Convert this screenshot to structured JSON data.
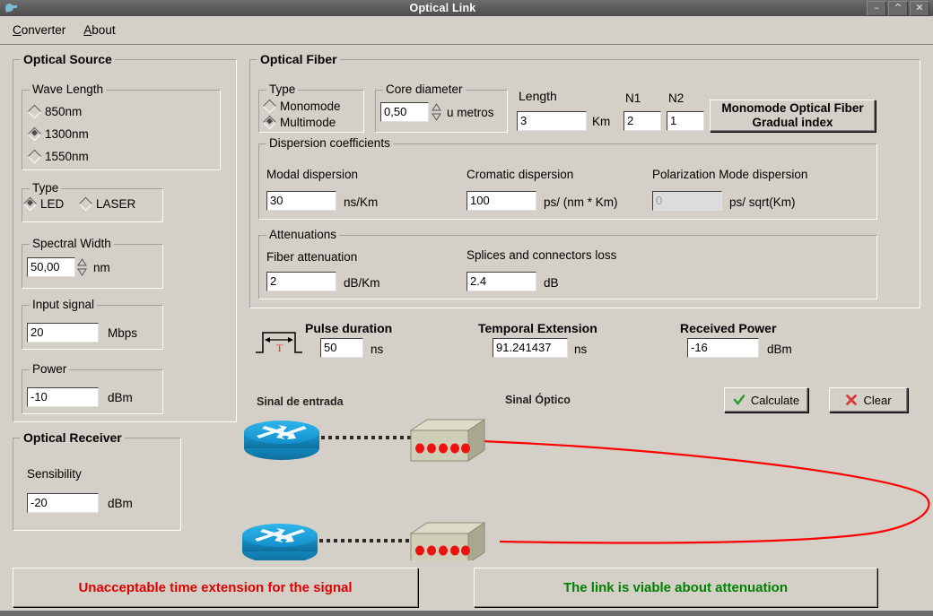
{
  "window": {
    "title": "Optical Link",
    "icon": "app-bird-icon",
    "controls": {
      "minimize": "–",
      "maximize": "^",
      "close": "✕"
    }
  },
  "menubar": {
    "items": [
      {
        "label": "Converter",
        "mnemonic": "C"
      },
      {
        "label": "About",
        "mnemonic": "A"
      }
    ]
  },
  "optical_source": {
    "title": "Optical Source",
    "wave_length": {
      "title": "Wave Length",
      "options": [
        {
          "label": "850nm",
          "selected": false
        },
        {
          "label": "1300nm",
          "selected": true
        },
        {
          "label": "1550nm",
          "selected": false
        }
      ]
    },
    "type": {
      "title": "Type",
      "options": [
        {
          "label": "LED",
          "selected": true
        },
        {
          "label": "LASER",
          "selected": false
        }
      ]
    },
    "spectral_width": {
      "title": "Spectral Width",
      "value": "50,00",
      "unit": "nm"
    },
    "input_signal": {
      "title": "Input signal",
      "value": "20",
      "unit": "Mbps"
    },
    "power": {
      "title": "Power",
      "value": "-10",
      "unit": "dBm"
    }
  },
  "optical_receiver": {
    "title": "Optical Receiver",
    "sensibility": {
      "label": "Sensibility",
      "value": "-20",
      "unit": "dBm"
    }
  },
  "optical_fiber": {
    "title": "Optical Fiber",
    "type": {
      "title": "Type",
      "options": [
        {
          "label": "Monomode",
          "selected": false
        },
        {
          "label": "Multimode",
          "selected": true
        }
      ]
    },
    "core_diameter": {
      "title": "Core diameter",
      "value": "0,50",
      "unit": "u metros"
    },
    "length": {
      "label": "Length",
      "value": "3",
      "unit": "Km"
    },
    "n1": {
      "label": "N1",
      "value": "2"
    },
    "n2": {
      "label": "N2",
      "value": "1"
    },
    "fiber_button": {
      "line1": "Monomode Optical Fiber",
      "line2": "Gradual index"
    },
    "dispersion": {
      "title": "Dispersion coefficients",
      "modal": {
        "label": "Modal dispersion",
        "value": "30",
        "unit": "ns/Km"
      },
      "chromatic": {
        "label": "Cromatic dispersion",
        "value": "100",
        "unit": "ps/ (nm * Km)"
      },
      "polarization": {
        "label": "Polarization Mode dispersion",
        "value": "0",
        "unit": "ps/ sqrt(Km)",
        "disabled": true
      }
    },
    "attenuations": {
      "title": "Attenuations",
      "fiber": {
        "label": "Fiber attenuation",
        "value": "2",
        "unit": "dB/Km"
      },
      "splices": {
        "label": "Splices and connectors loss",
        "value": "2.4",
        "unit": "dB"
      }
    }
  },
  "results": {
    "pulse_duration": {
      "label": "Pulse duration",
      "value": "50",
      "unit": "ns"
    },
    "temporal_extension": {
      "label": "Temporal Extension",
      "value": "91.241437",
      "unit": "ns"
    },
    "received_power": {
      "label": "Received Power",
      "value": "-16",
      "unit": "dBm"
    },
    "pulse_icon_letter": "T"
  },
  "actions": {
    "calculate": {
      "label": "Calculate",
      "icon": "check-icon",
      "color": "#2f9e2f"
    },
    "clear": {
      "label": "Clear",
      "icon": "cross-icon",
      "color": "#d93c3c"
    }
  },
  "diagram": {
    "label_input": "Sinal de entrada",
    "label_optical": "Sinal Óptico",
    "fiber_color": "#ff0000",
    "router_color": "#169bd5",
    "converter_color": "#c8c8b0",
    "led_color": "#ee1111"
  },
  "status": {
    "left": {
      "text": "Unacceptable time extension for the signal",
      "color": "#e00000"
    },
    "right": {
      "text": "The link is viable about attenuation",
      "color": "#008000"
    }
  }
}
